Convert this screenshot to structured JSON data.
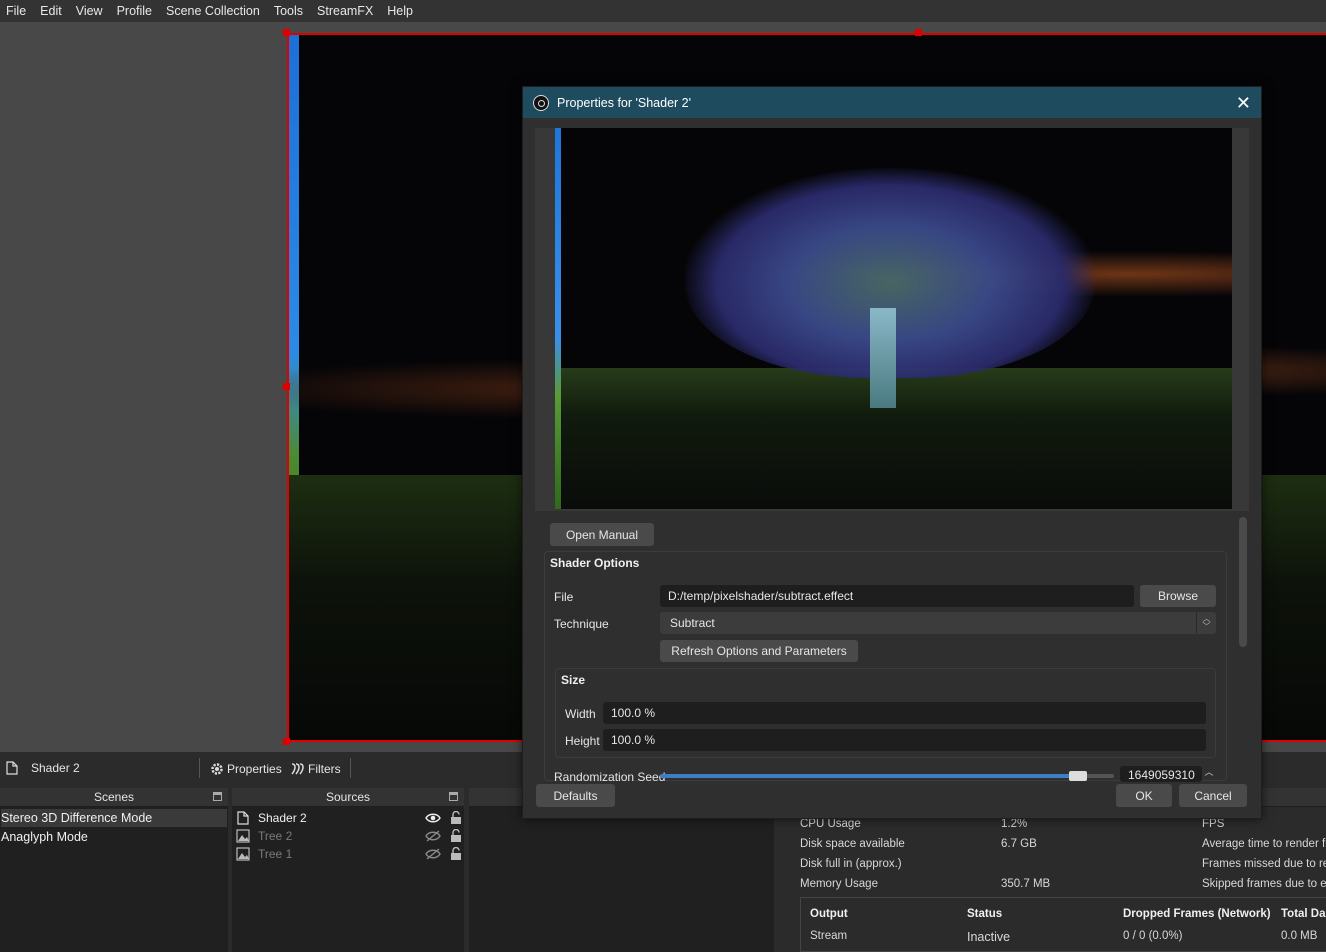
{
  "menu": [
    {
      "label": "File"
    },
    {
      "label": "Edit"
    },
    {
      "label": "View"
    },
    {
      "label": "Profile"
    },
    {
      "label": "Scene Collection"
    },
    {
      "label": "Tools"
    },
    {
      "label": "StreamFX"
    },
    {
      "label": "Help"
    }
  ],
  "dialog": {
    "title": "Properties for 'Shader 2'",
    "open_manual": "Open Manual",
    "shader_options_title": "Shader Options",
    "file_label": "File",
    "file_value": "D:/temp/pixelshader/subtract.effect",
    "browse": "Browse",
    "technique_label": "Technique",
    "technique_value": "Subtract",
    "refresh": "Refresh Options and Parameters",
    "size_title": "Size",
    "width_label": "Width",
    "width_value": "100.0 %",
    "height_label": "Height",
    "height_value": "100.0 %",
    "seed_label": "Randomization Seed",
    "seed_value": "1649059310",
    "seed_fraction": 0.92,
    "defaults": "Defaults",
    "ok": "OK",
    "cancel": "Cancel"
  },
  "source_toolbar": {
    "selected_source": "Shader 2",
    "properties": "Properties",
    "filters": "Filters"
  },
  "scenes": {
    "title": "Scenes",
    "items": [
      "Stereo 3D Difference Mode",
      "Anaglyph Mode"
    ]
  },
  "sources": {
    "title": "Sources",
    "items": [
      {
        "name": "Shader 2",
        "visible": true
      },
      {
        "name": "Tree 2",
        "visible": false
      },
      {
        "name": "Tree 1",
        "visible": false
      }
    ]
  },
  "stats": {
    "cpu_label": "CPU Usage",
    "cpu_value": "1.2%",
    "disk_label": "Disk space available",
    "disk_value": "6.7 GB",
    "diskfull_label": "Disk full in (approx.)",
    "mem_label": "Memory Usage",
    "mem_value": "350.7 MB",
    "fps_label": "FPS",
    "avg_label": "Average time to render fr",
    "missed_label": "Frames missed due to ren",
    "skipped_label": "Skipped frames due to en",
    "output_headers": [
      "Output",
      "Status",
      "Dropped Frames (Network)",
      "Total Da"
    ],
    "output_row": [
      "Stream",
      "Inactive",
      "0 / 0 (0.0%)",
      "0.0 MB"
    ]
  },
  "colors": {
    "selection_red": "#e00000",
    "titlebar": "#1e4c5e",
    "accent_blue": "#3d7ec6"
  }
}
